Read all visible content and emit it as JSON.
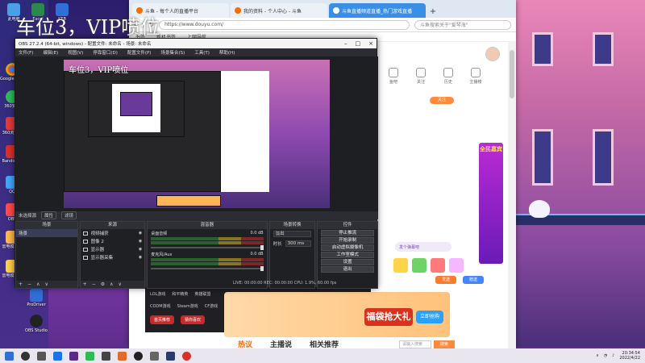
{
  "watermark": "车位3，VIP喷位",
  "canvas_watermark": "车位3，VIP喷位",
  "desktop_icons": [
    {
      "label": "此电脑"
    },
    {
      "label": "Google Chrome"
    },
    {
      "label": "360安全"
    },
    {
      "label": "360浏览器"
    },
    {
      "label": "Bandicam"
    },
    {
      "label": "QQ"
    },
    {
      "label": "OBS"
    },
    {
      "label": "雷电模拟器"
    },
    {
      "label": "ProDriver"
    },
    {
      "label": "OBS Studio"
    }
  ],
  "desktop_icons_top": [
    {
      "label": "此电脑"
    },
    {
      "label": "Excel"
    },
    {
      "label": "KEB"
    }
  ],
  "browser": {
    "tabs": [
      {
        "label": "斗鱼 - 每个人的直播平台"
      },
      {
        "label": "我的资料 - 个人中心 - 斗鱼"
      },
      {
        "label": "斗鱼直播频道直播_热门游戏直播"
      }
    ],
    "new_tab": "+",
    "url": "https://www.douyu.com/",
    "search_placeholder": "斗鱼搜索关于\"爱琴海\"",
    "bookmarks": [
      "书签",
      "新机书签",
      "上网导航"
    ]
  },
  "page": {
    "quick_icons": [
      "鱼吧",
      "关注",
      "历史",
      "主播榜"
    ],
    "orange_pill": "关注",
    "promo_title": "全民嘉宾",
    "chat_input_placeholder": "发个弹幕吧",
    "btn_orange": "发送",
    "btn_blue": "赠送",
    "below_row_1": [
      "LOL游戏",
      "和平精英",
      "英雄联盟"
    ],
    "below_row_2": [
      "CODM游戏",
      "Steam游戏",
      "CF游戏"
    ],
    "below_pills": [
      "首页推荐",
      "猜你喜欢"
    ],
    "banner_title": "福袋抢大礼",
    "banner_button": "立即抢购",
    "bottom_tabs": [
      "热议",
      "主播说",
      "相关推荐"
    ],
    "bottom_input_placeholder": "请输入搜索",
    "bottom_search": "搜索"
  },
  "obs": {
    "title": "OBS 27.2.4 (64-bit, windows) - 配置文件: 未命名 - 场景: 未命名",
    "menu": [
      "文件(F)",
      "编辑(E)",
      "视图(V)",
      "停靠窗口(D)",
      "配置文件(P)",
      "场景集合(S)",
      "工具(T)",
      "帮助(H)"
    ],
    "scenebar_label": "未选择源",
    "scenebar_buttons": [
      "属性",
      "滤镜"
    ],
    "docks": {
      "scenes": "场景",
      "sources": "来源",
      "mixer": "混音器",
      "transitions": "场景转换",
      "controls": "控件"
    },
    "scene_item": "场景",
    "sources": [
      {
        "label": "视频捕获"
      },
      {
        "label": "图像 2"
      },
      {
        "label": "显示器"
      },
      {
        "label": "显示器采集"
      }
    ],
    "mixer": [
      {
        "label": "桌面音频",
        "db": "0.0 dB"
      },
      {
        "label": "麦克风/Aux",
        "db": "0.0 dB"
      }
    ],
    "transition": {
      "value": "淡出",
      "duration_label": "时长",
      "duration_value": "300 ms"
    },
    "controls": [
      "停止推流",
      "开始录制",
      "启动虚拟摄像机",
      "工作室模式",
      "设置",
      "退出"
    ],
    "status": "LIVE: 00:00:00   REC: 00:00:00   CPU: 1.9%, 60.00 fps"
  },
  "taskbar": {
    "time": "20:34:54",
    "date": "2022/4/22"
  },
  "colors": {
    "accent_blue": "#3a8ee6",
    "douyu_orange": "#ff6a00",
    "obs_bg": "#2b2d33"
  }
}
